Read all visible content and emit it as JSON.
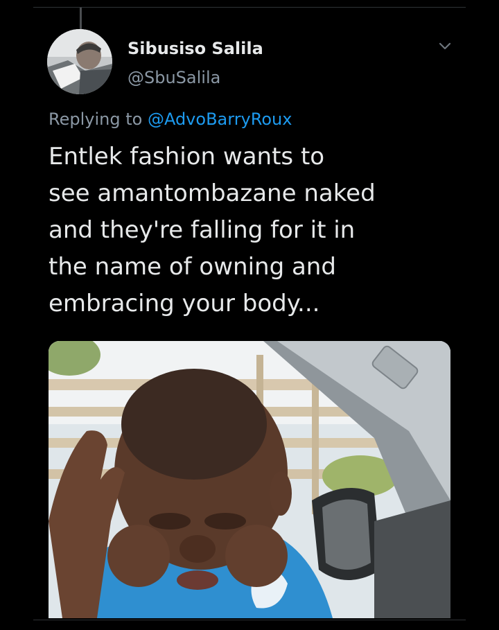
{
  "tweet": {
    "author_name": "Sibusiso Salila",
    "author_handle": "@SbuSalila",
    "reply_prefix": "Replying to",
    "reply_mention": "@AdvoBarryRoux",
    "text": "Entlek fashion wants to\nsee amantombazane naked\nand they're falling for it in\nthe name of owning and\nembracing your body...",
    "avatar_icon": "profile-photo",
    "more_icon": "chevron-down-icon",
    "media": {
      "description_icon": "photo-thumbnail",
      "kind": "photo"
    }
  },
  "colors": {
    "background": "#000000",
    "text_primary": "#e7e9ea",
    "text_secondary": "#8b98a5",
    "link": "#1d9bf0",
    "divider": "#2f3336"
  }
}
